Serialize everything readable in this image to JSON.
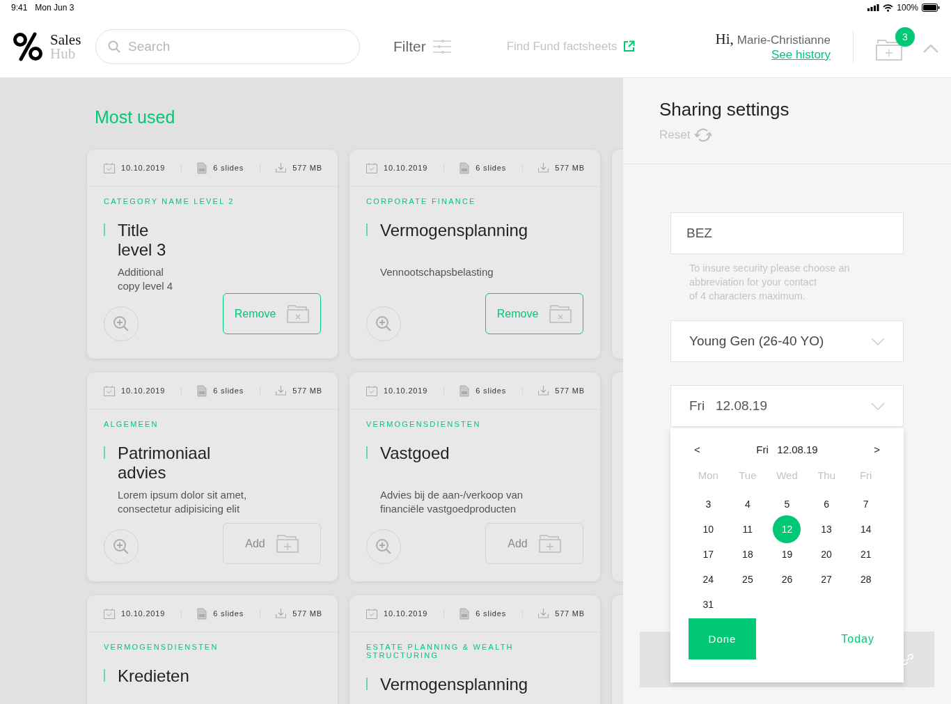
{
  "status_bar": {
    "time": "9:41",
    "date": "Mon Jun 3",
    "battery": "100%"
  },
  "header": {
    "logo": {
      "line1": "Sales",
      "line2": "Hub"
    },
    "search": {
      "placeholder": "Search"
    },
    "filter": "Filter",
    "factsheets": "Find Fund factsheets",
    "greeting": "Hi,",
    "user": "Marie-Christianne",
    "history": "See history",
    "badge": "3"
  },
  "section_title": "Most used",
  "cards": [
    {
      "date": "10.10.2019",
      "slides": "6 slides",
      "size": "577 MB",
      "category": "CATEGORY NAME LEVEL 2",
      "title": "Title\nlevel 3",
      "description": "Additional\ncopy level 4",
      "action": {
        "kind": "remove",
        "label": "Remove"
      }
    },
    {
      "date": "10.10.2019",
      "slides": "6 slides",
      "size": "577 MB",
      "category": "CORPORATE FINANCE",
      "title": "Vermogensplanning",
      "description": "Vennootschapsbelasting",
      "action": {
        "kind": "remove",
        "label": "Remove"
      }
    },
    {
      "date": "10.10.2019",
      "slides": "6 slides",
      "size": "577 MB",
      "category": "ALGEMEEN",
      "title": "Patrimoniaal\nadvies",
      "description": "Lorem ipsum dolor sit amet,\nconsectetur adipisicing elit",
      "action": {
        "kind": "add",
        "label": "Add"
      }
    },
    {
      "date": "10.10.2019",
      "slides": "6 slides",
      "size": "577 MB",
      "category": "VERMOGENSDIENSTEN",
      "title": "Vastgoed",
      "description": "Advies bij de aan-/verkoop van\nfinanciële vastgoedproducten",
      "action": {
        "kind": "add",
        "label": "Add"
      }
    },
    {
      "date": "10.10.2019",
      "slides": "6 slides",
      "size": "577 MB",
      "category": "VERMOGENSDIENSTEN",
      "title": "Kredieten"
    },
    {
      "date": "10.10.2019",
      "slides": "6 slides",
      "size": "577 MB",
      "category": "ESTATE PLANNING & WEALTH STRUCTURING",
      "title": "Vermogensplanning"
    }
  ],
  "right_panel": {
    "title": "Sharing settings",
    "reset": "Reset",
    "abbreviation": {
      "value": "BEZ"
    },
    "hint": "To insure security please choose an\nabbreviation for your contact\nof 4 characters maximum.",
    "segment": "Young Gen (26-40 YO)",
    "date_field": {
      "day": "Fri",
      "date": "12.08.19"
    },
    "calendar": {
      "prev": "<",
      "next": ">",
      "day": "Fri",
      "date": "12.08.19",
      "weekdays": [
        "Mon",
        "Tue",
        "Wed",
        "Thu",
        "Fri"
      ],
      "days": [
        {
          "label": "3",
          "selected": false
        },
        {
          "label": "4",
          "selected": false
        },
        {
          "label": "5",
          "selected": false
        },
        {
          "label": "6",
          "selected": false
        },
        {
          "label": "7",
          "selected": false
        },
        {
          "label": "10",
          "selected": false
        },
        {
          "label": "11",
          "selected": false
        },
        {
          "label": "12",
          "selected": true
        },
        {
          "label": "13",
          "selected": false
        },
        {
          "label": "14",
          "selected": false
        },
        {
          "label": "17",
          "selected": false
        },
        {
          "label": "18",
          "selected": false
        },
        {
          "label": "19",
          "selected": false
        },
        {
          "label": "20",
          "selected": false
        },
        {
          "label": "21",
          "selected": false
        },
        {
          "label": "24",
          "selected": false
        },
        {
          "label": "25",
          "selected": false
        },
        {
          "label": "26",
          "selected": false
        },
        {
          "label": "27",
          "selected": false
        },
        {
          "label": "28",
          "selected": false
        },
        {
          "label": "31",
          "selected": false
        }
      ],
      "done": "Done",
      "today": "Today"
    }
  }
}
